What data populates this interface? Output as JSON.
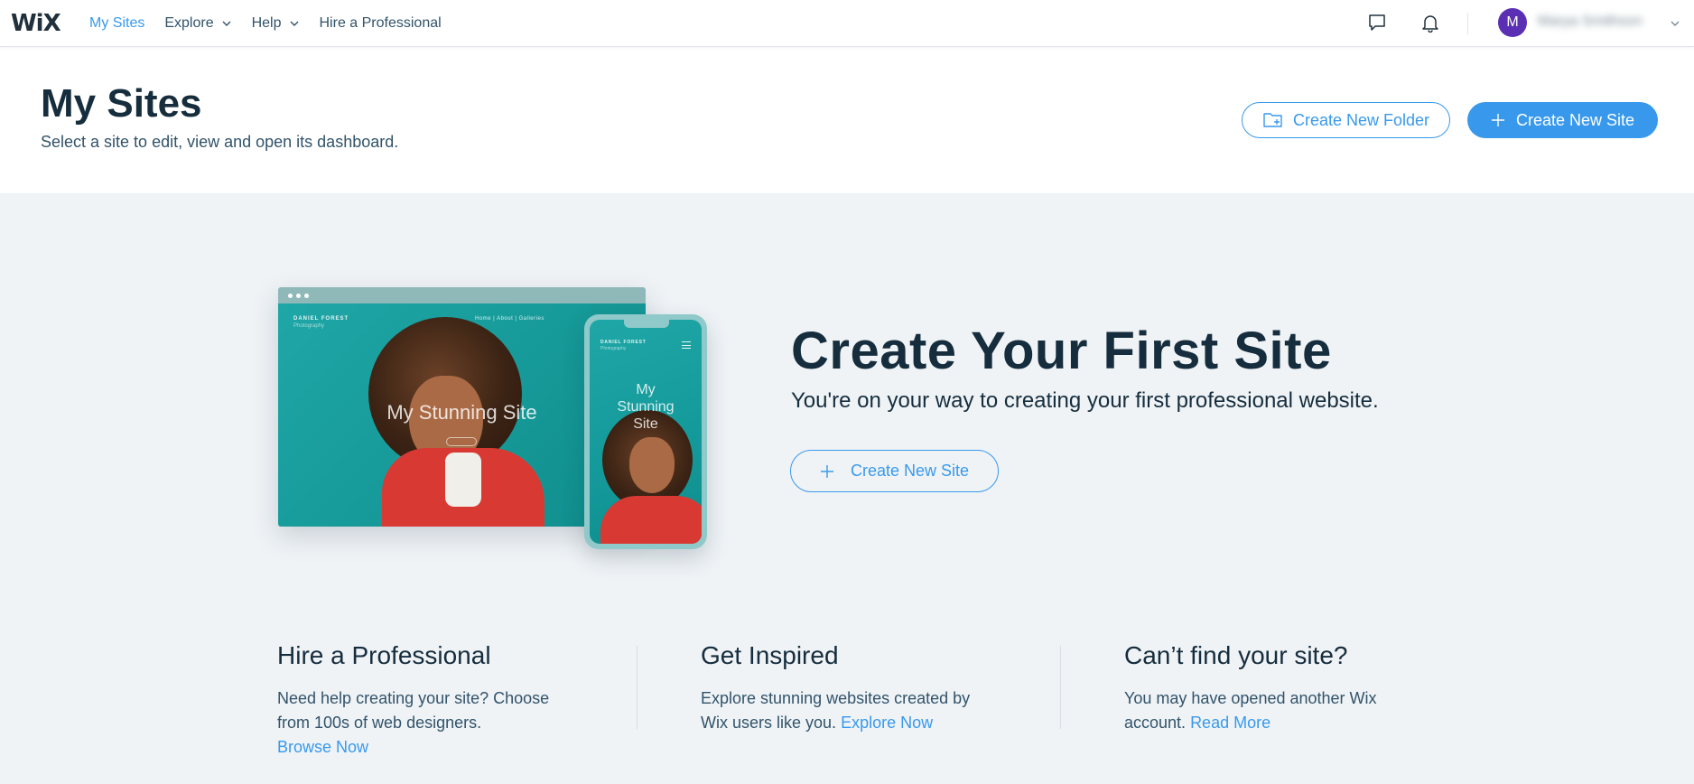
{
  "nav": {
    "logo": "WiX",
    "items": [
      {
        "label": "My Sites",
        "active": true,
        "has_dropdown": false
      },
      {
        "label": "Explore",
        "active": false,
        "has_dropdown": true
      },
      {
        "label": "Help",
        "active": false,
        "has_dropdown": true
      },
      {
        "label": "Hire a Professional",
        "active": false,
        "has_dropdown": false
      }
    ],
    "icons": [
      "chat-icon",
      "bell-icon"
    ],
    "user": {
      "avatar_initial": "M",
      "name": "Marya Smithson"
    }
  },
  "header": {
    "title": "My Sites",
    "subtitle": "Select a site to edit, view and open its dashboard.",
    "folder_button": "Create New Folder",
    "site_button": "Create New Site"
  },
  "illustration": {
    "brand": "DANIEL FOREST",
    "brand_sub": "Photography",
    "menu": "Home  |  About  |  Galleries",
    "site_name": "My Stunning Site",
    "phone_site_name": "My Stunning Site"
  },
  "hero": {
    "title": "Create Your First Site",
    "subtitle": "You're on your way to creating your first professional website.",
    "button": "Create New Site"
  },
  "columns": [
    {
      "title": "Hire a Professional",
      "text": "Need help creating your site? Choose from 100s of web designers.",
      "link": "Browse Now"
    },
    {
      "title": "Get Inspired",
      "text": "Explore stunning websites created by Wix users like you.",
      "link": "Explore Now"
    },
    {
      "title": "Can’t find your site?",
      "text": "You may have opened another Wix account.",
      "link": "Read More"
    }
  ],
  "colors": {
    "accent": "#3899ec",
    "title": "#162d3d",
    "background": "#eff3f6",
    "avatar": "#5b2fb3"
  }
}
